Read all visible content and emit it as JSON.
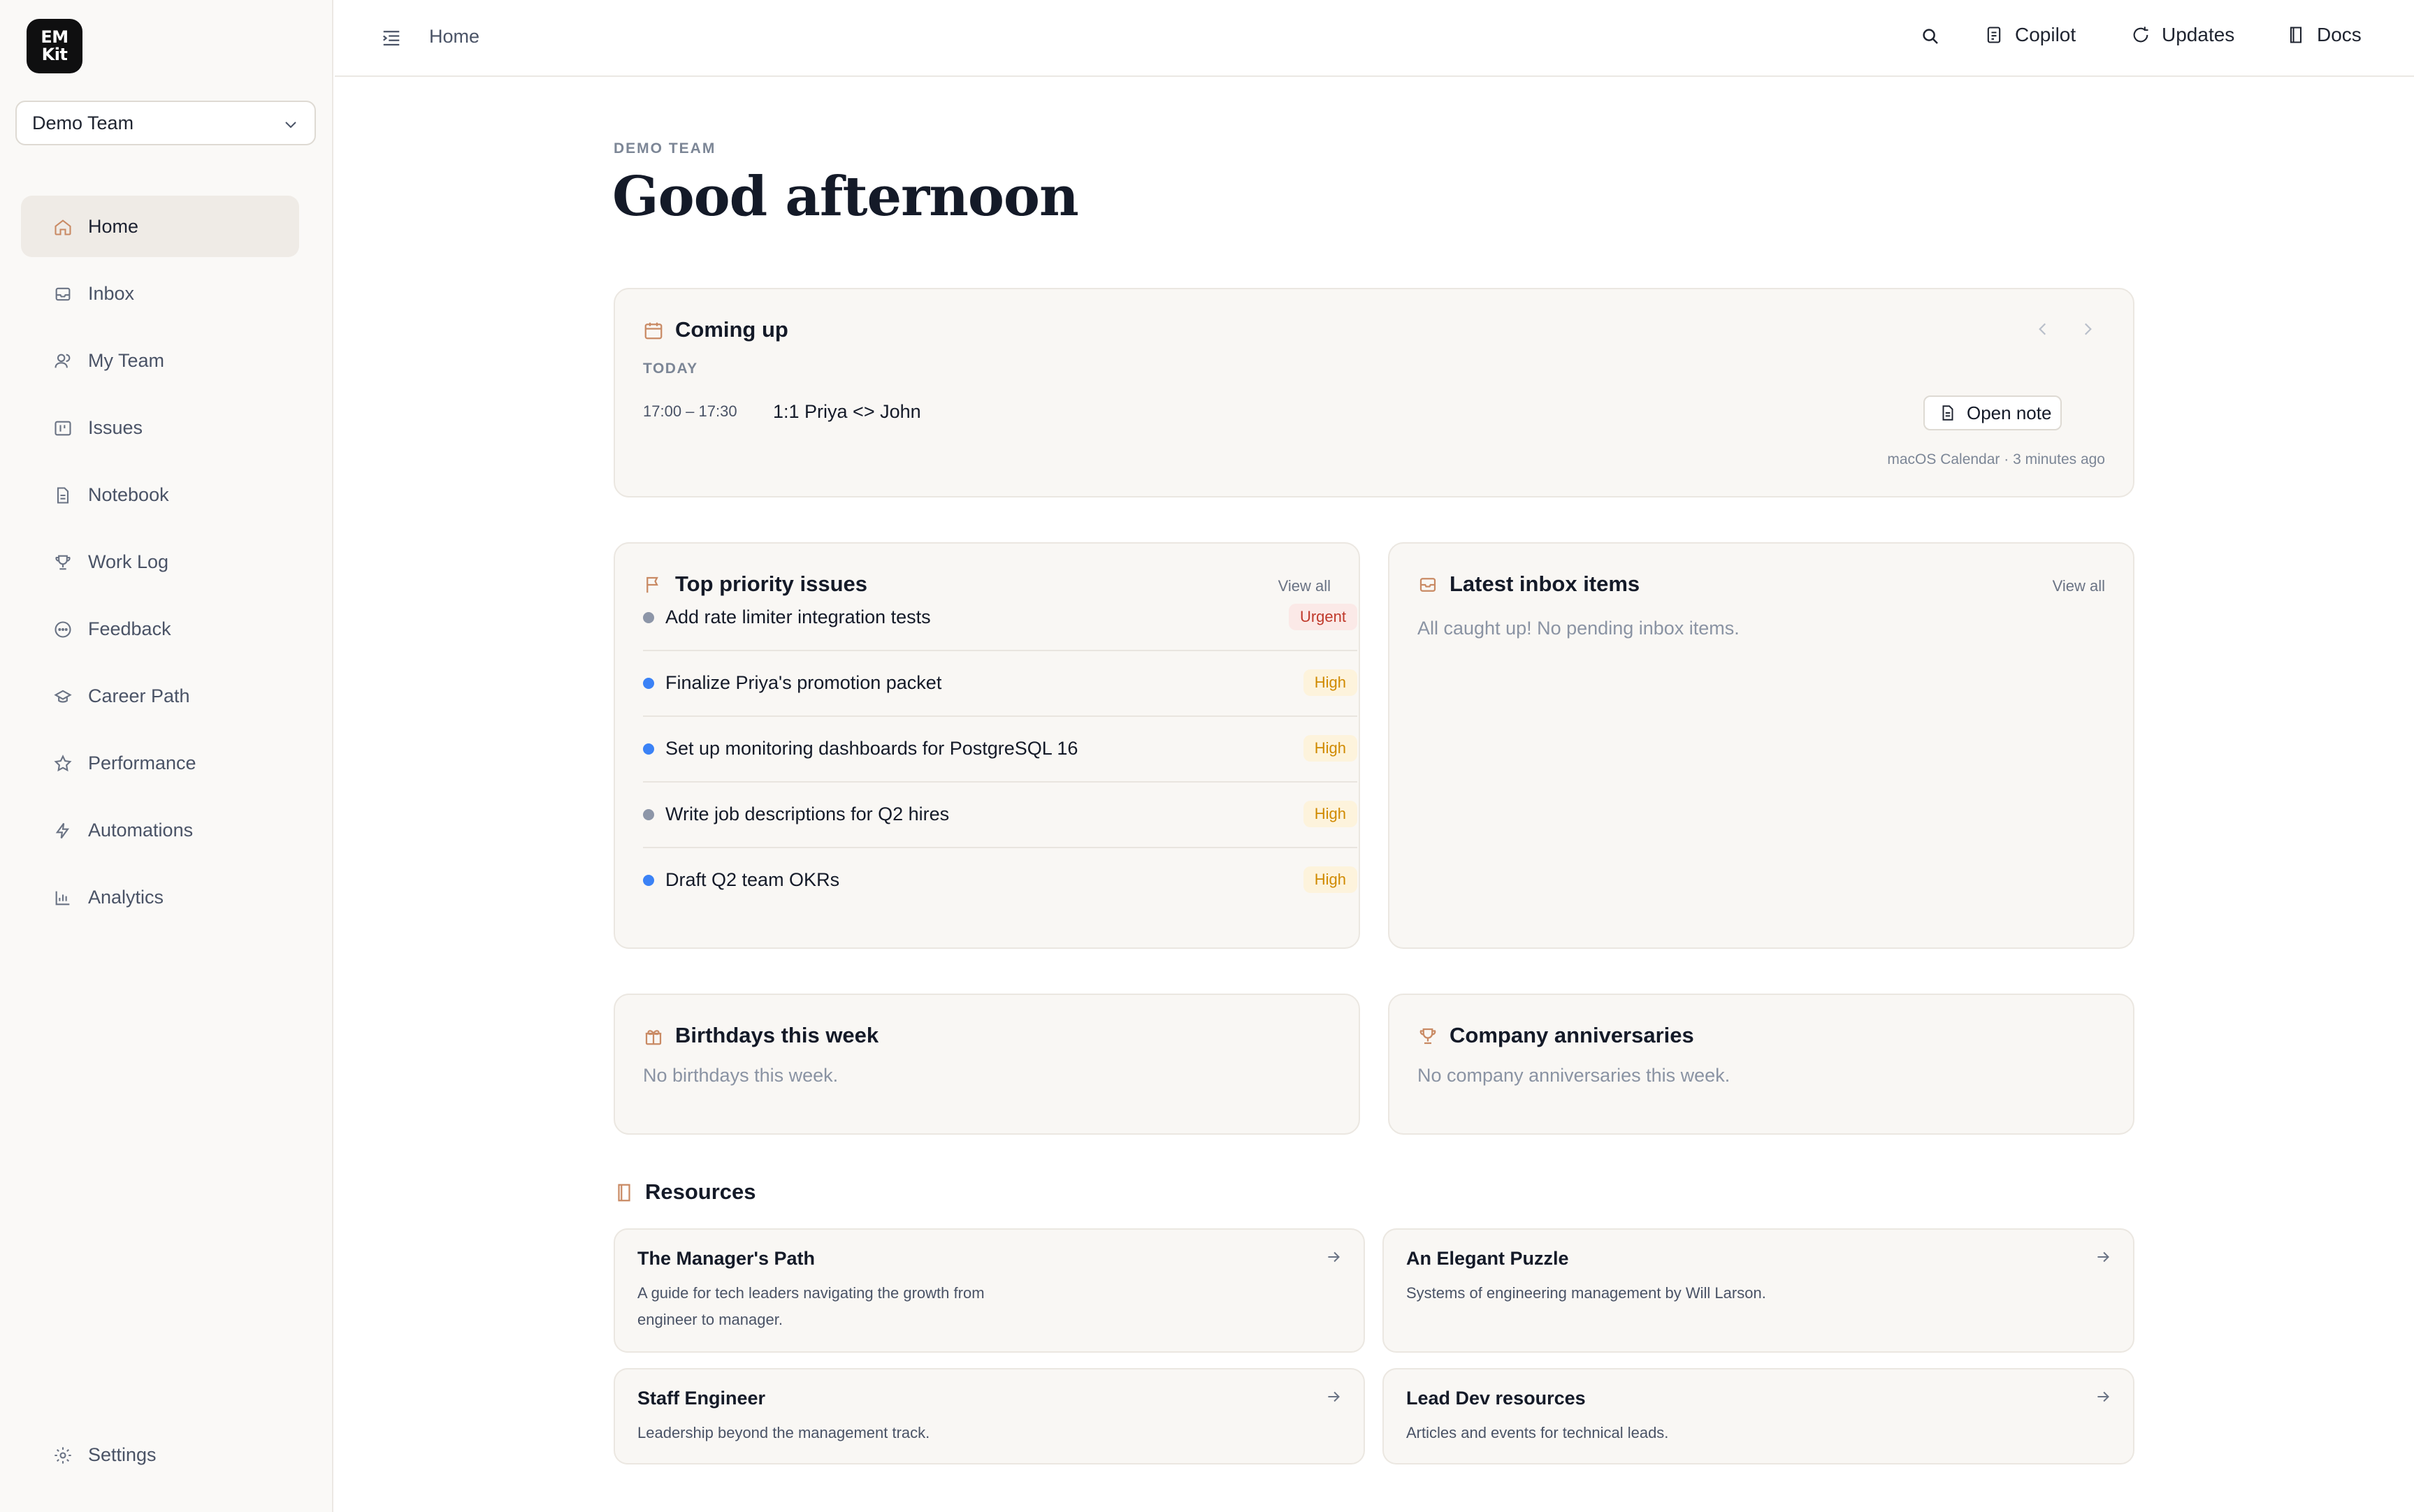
{
  "app": {
    "logo_line1": "EM",
    "logo_line2": "Kit"
  },
  "sidebar": {
    "team_select": "Demo Team",
    "items": [
      {
        "label": "Home",
        "icon": "home-icon",
        "active": true
      },
      {
        "label": "Inbox",
        "icon": "inbox-icon"
      },
      {
        "label": "My Team",
        "icon": "users-icon"
      },
      {
        "label": "Issues",
        "icon": "kanban-icon"
      },
      {
        "label": "Notebook",
        "icon": "file-icon"
      },
      {
        "label": "Work Log",
        "icon": "trophy-icon"
      },
      {
        "label": "Feedback",
        "icon": "message-icon"
      },
      {
        "label": "Career Path",
        "icon": "career-icon"
      },
      {
        "label": "Performance",
        "icon": "star-icon"
      },
      {
        "label": "Automations",
        "icon": "bolt-icon"
      },
      {
        "label": "Analytics",
        "icon": "chart-icon"
      }
    ],
    "settings_label": "Settings"
  },
  "topbar": {
    "breadcrumb": "Home",
    "copilot": "Copilot",
    "updates": "Updates",
    "docs": "Docs"
  },
  "main": {
    "eyebrow": "DEMO TEAM",
    "greeting": "Good afternoon",
    "coming_up": {
      "title": "Coming up",
      "section": "TODAY",
      "event_time": "17:00 – 17:30",
      "event_title": "1:1 Priya <> John",
      "open_note": "Open note",
      "source": "macOS Calendar · 3 minutes ago"
    },
    "issues": {
      "title": "Top priority issues",
      "view_all": "View all",
      "items": [
        {
          "title": "Add rate limiter integration tests",
          "priority": "Urgent",
          "dot": "#8d96a8"
        },
        {
          "title": "Finalize Priya's promotion packet",
          "priority": "High",
          "dot": "#3b82f6"
        },
        {
          "title": "Set up monitoring dashboards for PostgreSQL 16",
          "priority": "High",
          "dot": "#3b82f6"
        },
        {
          "title": "Write job descriptions for Q2 hires",
          "priority": "High",
          "dot": "#8d96a8"
        },
        {
          "title": "Draft Q2 team OKRs",
          "priority": "High",
          "dot": "#3b82f6"
        }
      ]
    },
    "inbox": {
      "title": "Latest inbox items",
      "view_all": "View all",
      "empty": "All caught up! No pending inbox items."
    },
    "birthdays": {
      "title": "Birthdays this week",
      "empty": "No birthdays this week."
    },
    "anniversaries": {
      "title": "Company anniversaries",
      "empty": "No company anniversaries this week."
    },
    "resources": {
      "title": "Resources",
      "items": [
        {
          "title": "The Manager's Path",
          "desc": "A guide for tech leaders navigating the growth from engineer to manager."
        },
        {
          "title": "An Elegant Puzzle",
          "desc": "Systems of engineering management by Will Larson."
        },
        {
          "title": "Staff Engineer",
          "desc": "Leadership beyond the management track."
        },
        {
          "title": "Lead Dev resources",
          "desc": "Articles and events for technical leads."
        }
      ]
    }
  },
  "colors": {
    "accent_icon": "#c98a64",
    "urgent_text": "#c0392b",
    "urgent_bg": "#fbe9e7",
    "high_text": "#d08a00",
    "high_bg": "#fdf3dc"
  }
}
